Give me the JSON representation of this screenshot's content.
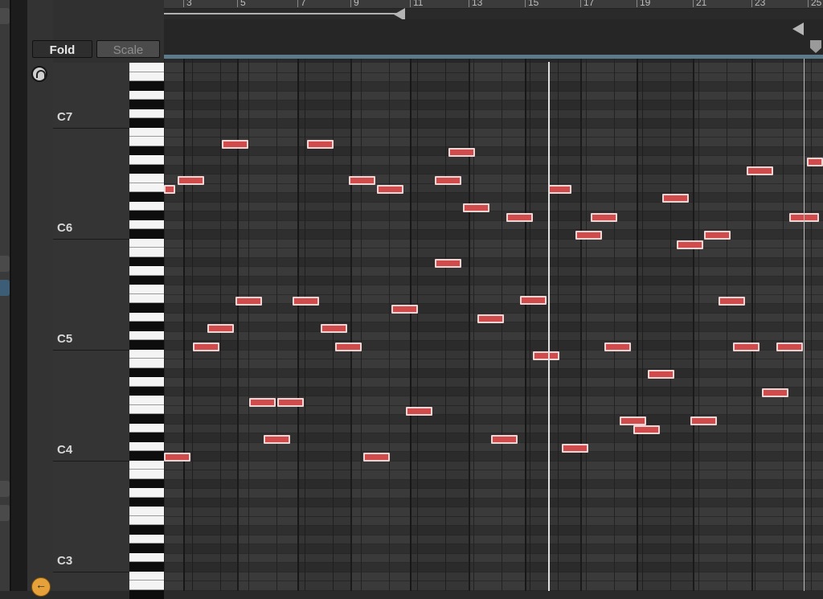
{
  "ruler": {
    "bars": [
      "3",
      "5",
      "7",
      "9",
      "11",
      "13",
      "15",
      "17",
      "19",
      "21",
      "23",
      "25"
    ]
  },
  "toolbar": {
    "fold_label": "Fold",
    "scale_label": "Scale"
  },
  "octave_labels": [
    "C7",
    "C6",
    "C5",
    "C4",
    "C3"
  ],
  "colors": {
    "note_fill": "#d04c4c",
    "note_border": "#f0d5d5",
    "accent_blue": "#5b7a8a",
    "playhead": "#e0e0e0"
  },
  "icons": {
    "top": "headphones-icon",
    "bottom": "back-arrow-icon"
  }
}
